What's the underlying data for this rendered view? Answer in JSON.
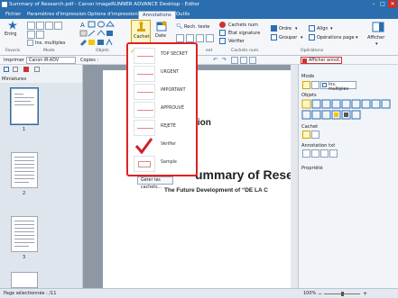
{
  "window": {
    "title": "Summary of Research.pdf - Canon imageRUNNER ADVANCE Desktop - Editor"
  },
  "tabs": [
    "Fichier",
    "Paramètres d'impression",
    "Options d'impression",
    "Annotations",
    "Outils"
  ],
  "ribbon": {
    "favoris_label": "Favoris",
    "mode_label": "Mode",
    "objets_label": "Objets",
    "entrg_label": "Entrg",
    "ins_multiples_label": "Ins. multiples",
    "cachet_label": "Cachet",
    "date_label": "Date",
    "rech_texte_label": "Rech. texte",
    "cachets_num_label": "Cachets num",
    "etat_signature_label": "État signature",
    "verifier_label": "Vérifier",
    "cachets_num_group": "Cachets num.",
    "ordre_label": "Ordre",
    "grouper_label": "Grouper",
    "align_label": "Align",
    "operations_page_label": "Opérations page",
    "operations_label": "Opérations",
    "afficher_label": "Afficher",
    "afficher_annot_label": "Afficher annot.",
    "ext_label": "ext"
  },
  "toolbar2": {
    "imprimer_label": "Imprimer :",
    "printer_value": "Canon iR-ADV",
    "copies_label": "Copies :"
  },
  "left_panel": {
    "title": "Miniatures",
    "pages": [
      "1",
      "2",
      "3"
    ]
  },
  "document": {
    "heading_fragment": "ation",
    "title_fragment": "ummary of Resea",
    "subtitle_fragment": "The Future Development of “DE LA C"
  },
  "dropdown": {
    "items": [
      {
        "label": "TOP SECRET",
        "checked": true
      },
      {
        "label": "URGENT",
        "checked": false
      },
      {
        "label": "IMPORTANT",
        "checked": false
      },
      {
        "label": "APPROUVÉ",
        "checked": false
      },
      {
        "label": "REJETÉ",
        "checked": false
      },
      {
        "label": "Vérifier",
        "checked": false
      },
      {
        "label": "Sample",
        "checked": false
      }
    ],
    "manage_label": "Gérer les cachets..."
  },
  "right_panel": {
    "mode_title": "Mode",
    "ins_multiples_label": "Ins. multiples",
    "objets_title": "Objets",
    "cachet_title": "Cachet",
    "annotation_title": "Annotation txt",
    "propriete_title": "Propriété"
  },
  "status": {
    "page_info": "Page sélectionnée : /11",
    "zoom": "100%"
  },
  "colors": {
    "accent": "#2a6eb0",
    "dropdown_border": "#e02020",
    "check": "#e0a000"
  }
}
